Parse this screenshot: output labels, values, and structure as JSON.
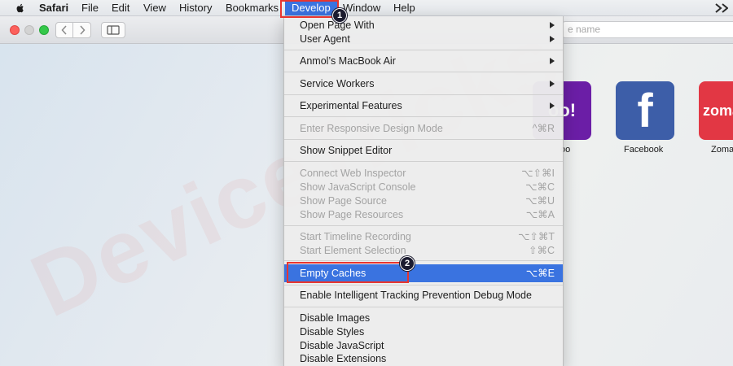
{
  "menubar": {
    "app_name": "Safari",
    "items": [
      "File",
      "Edit",
      "View",
      "History",
      "Bookmarks",
      "Develop",
      "Window",
      "Help"
    ],
    "active_item": "Develop"
  },
  "toolbar": {
    "address_placeholder": "e name"
  },
  "favorites": [
    {
      "name": "oo",
      "tile_text": "oo!",
      "color": "#6b1ea6"
    },
    {
      "name": "Facebook",
      "tile_text": "f",
      "color": "#3d5ea8"
    },
    {
      "name": "Zoma",
      "tile_text": "zoma",
      "color": "#e23744"
    }
  ],
  "watermark": "DeviceTricks",
  "develop_menu": {
    "items": [
      {
        "label": "Open Page With",
        "submenu": true,
        "enabled": true
      },
      {
        "label": "User Agent",
        "submenu": true,
        "enabled": true
      },
      {
        "label": "Anmol’s MacBook Air",
        "submenu": true,
        "enabled": true
      },
      {
        "label": "Service Workers",
        "submenu": true,
        "enabled": true
      },
      {
        "label": "Experimental Features",
        "submenu": true,
        "enabled": true
      },
      {
        "label": "Enter Responsive Design Mode",
        "shortcut": "^⌘R",
        "enabled": false
      },
      {
        "label": "Show Snippet Editor",
        "enabled": true
      },
      {
        "label": "Connect Web Inspector",
        "shortcut": "⌥⇧⌘I",
        "enabled": false
      },
      {
        "label": "Show JavaScript Console",
        "shortcut": "⌥⌘C",
        "enabled": false
      },
      {
        "label": "Show Page Source",
        "shortcut": "⌥⌘U",
        "enabled": false
      },
      {
        "label": "Show Page Resources",
        "shortcut": "⌥⌘A",
        "enabled": false
      },
      {
        "label": "Start Timeline Recording",
        "shortcut": "⌥⇧⌘T",
        "enabled": false
      },
      {
        "label": "Start Element Selection",
        "shortcut": "⇧⌘C",
        "enabled": false
      },
      {
        "label": "Empty Caches",
        "shortcut": "⌥⌘E",
        "enabled": true,
        "highlighted": true
      },
      {
        "label": "Enable Intelligent Tracking Prevention Debug Mode",
        "enabled": true
      },
      {
        "label": "Disable Images",
        "enabled": true
      },
      {
        "label": "Disable Styles",
        "enabled": true
      },
      {
        "label": "Disable JavaScript",
        "enabled": true
      },
      {
        "label": "Disable Extensions",
        "enabled": true
      }
    ]
  },
  "annotations": {
    "step1": "1",
    "step2": "2",
    "accent_color": "#e8352f"
  },
  "colors": {
    "highlight": "#3a73e0"
  }
}
